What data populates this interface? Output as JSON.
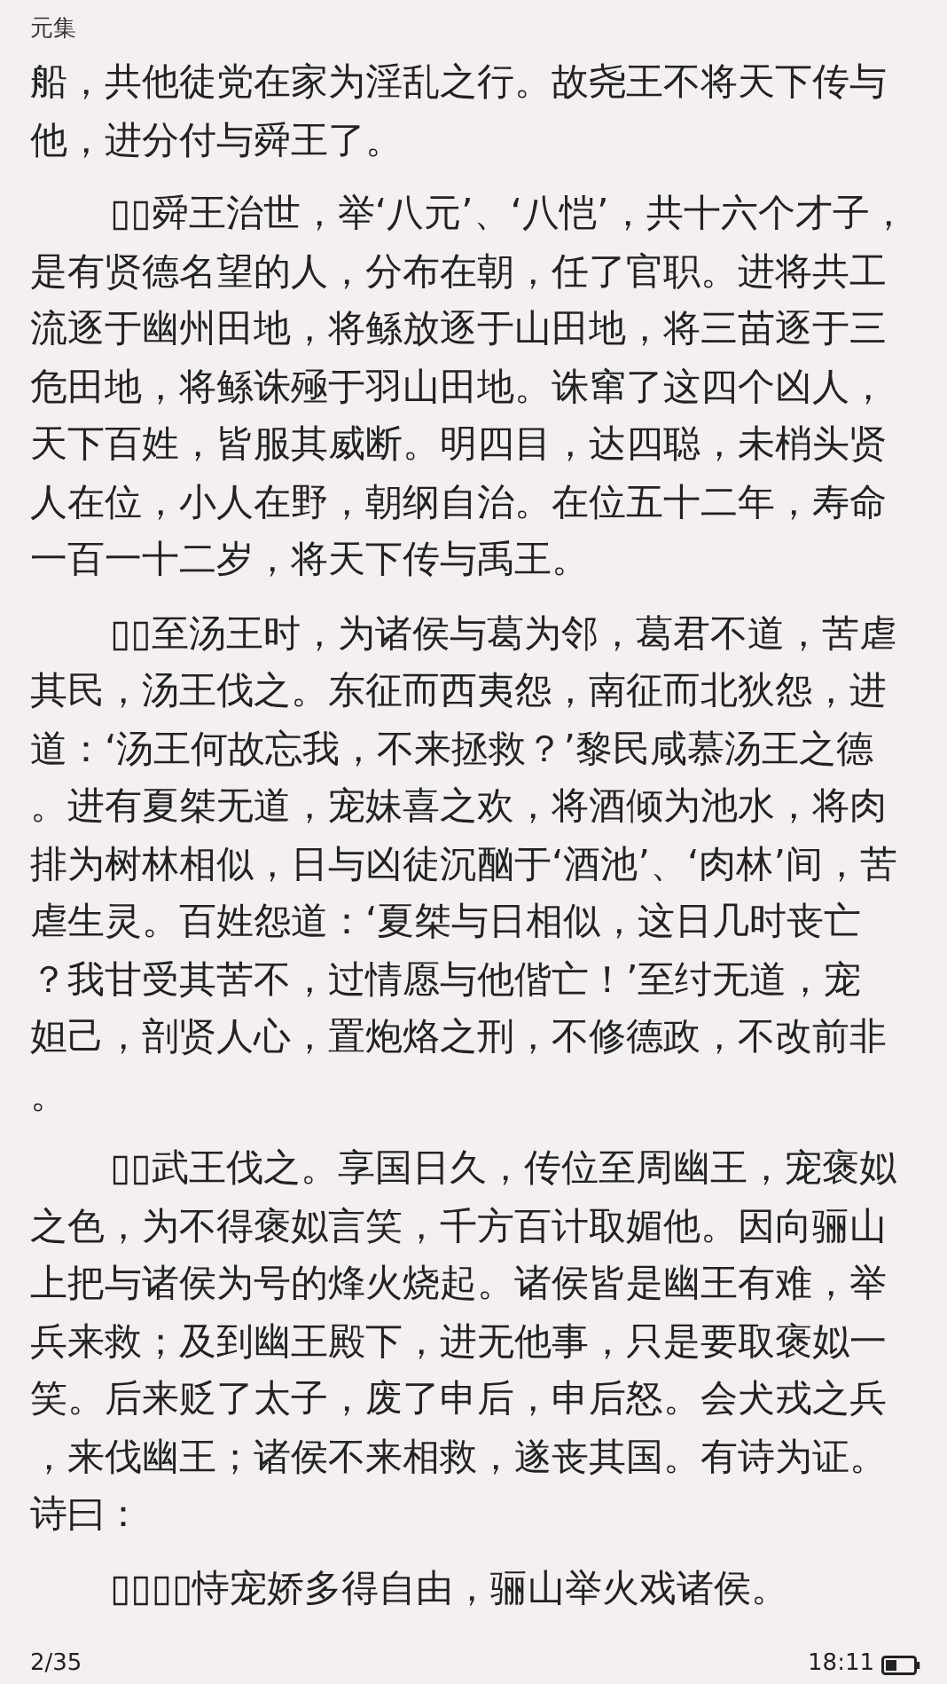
{
  "header": {
    "title": "元集"
  },
  "paragraphs": [
    {
      "indented": false,
      "lines": [
        "船，共他徒党在家为淫乱之行。故尧王不将天下传与",
        "他，进分付与舜王了。"
      ]
    },
    {
      "indented": true,
      "lines": [
        "▯▯舜王治世，举‘八元’、‘八恺’，共十六个才子，",
        "是有贤德名望的人，分布在朝，任了官职。进将共工",
        "流逐于幽州田地，将鲧放逐于山田地，将三苗逐于三",
        "危田地，将鲧诛殛于羽山田地。诛窜了这四个凶人，",
        "天下百姓，皆服其威断。明四目，达四聪，未梢头贤",
        "人在位，小人在野，朝纲自治。在位五十二年，寿命",
        "一百一十二岁，将天下传与禹王。"
      ]
    },
    {
      "indented": true,
      "lines": [
        "▯▯至汤王时，为诸侯与葛为邻，葛君不道，苦虐",
        "其民，汤王伐之。东征而西夷怨，南征而北狄怨，进",
        "道：‘汤王何故忘我，不来拯救？’黎民咸慕汤王之德",
        "。进有夏桀无道，宠妹喜之欢，将酒倾为池水，将肉",
        "排为树林相似，日与凶徒沉酗于‘酒池’、‘肉林’间，苦",
        "虐生灵。百姓怨道：‘夏桀与日相似，这日几时丧亡",
        "？我甘受其苦不，过情愿与他偕亡！’至纣无道，宠",
        "妲己，剖贤人心，置炮烙之刑，不修德政，不改前非",
        "。"
      ]
    },
    {
      "indented": true,
      "lines": [
        "▯▯武王伐之。享国日久，传位至周幽王，宠褒姒",
        "之色，为不得褒姒言笑，千方百计取媚他。因向骊山",
        "上把与诸侯为号的烽火烧起。诸侯皆是幽王有难，举",
        "兵来救；及到幽王殿下，进无他事，只是要取褒姒一",
        "笑。后来贬了太子，废了申后，申后怒。会犬戎之兵",
        "，来伐幽王；诸侯不来相救，遂丧其国。有诗为证。",
        "诗曰："
      ]
    },
    {
      "indented": true,
      "lines": [
        "▯▯▯▯恃宠娇多得自由，骊山举火戏诸侯。"
      ]
    }
  ],
  "footer": {
    "page": "2/35",
    "time": "18:11"
  }
}
